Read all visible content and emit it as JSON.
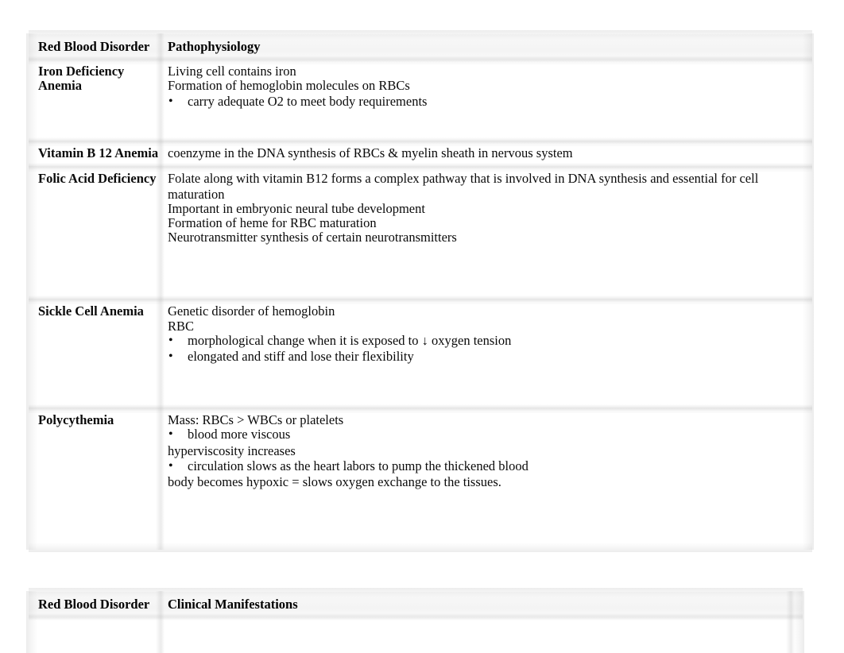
{
  "document": {
    "title": "Red Blood Disorders Study Table",
    "font_color": "#000000",
    "page_background": "#ffffff",
    "header_band_color": "#f4f4f4"
  },
  "table1": {
    "headers": {
      "col1": "Red Blood Disorder",
      "col2": "Pathophysiology"
    },
    "rows": [
      {
        "label": "Iron Deficiency Anemia",
        "label_line1": "Iron Deficiency",
        "label_line2": "Anemia",
        "lines": [
          {
            "type": "plain",
            "text": "Living cell contains iron"
          },
          {
            "type": "plain",
            "text": "Formation of hemoglobin molecules on RBCs"
          },
          {
            "type": "bullet",
            "text": "carry adequate O2 to meet body requirements"
          }
        ]
      },
      {
        "label": "Vitamin B 12 Anemia",
        "lines": [
          {
            "type": "plain",
            "text": "coenzyme in the DNA synthesis of RBCs & myelin sheath in nervous system"
          }
        ]
      },
      {
        "label": "Folic Acid Deficiency",
        "lines": [
          {
            "type": "plain",
            "text": "Folate along with vitamin B12 forms a complex pathway that is involved in DNA synthesis and essential for cell"
          },
          {
            "type": "plain",
            "text": "maturation"
          },
          {
            "type": "plain",
            "text": "Important in embryonic neural tube development"
          },
          {
            "type": "plain",
            "text": "Formation of heme for RBC maturation"
          },
          {
            "type": "plain",
            "text": "Neurotransmitter synthesis of certain neurotransmitters"
          }
        ]
      },
      {
        "label": "Sickle Cell Anemia",
        "lines": [
          {
            "type": "plain",
            "text": "Genetic disorder of hemoglobin"
          },
          {
            "type": "plain",
            "text": "RBC"
          },
          {
            "type": "bullet",
            "text": "morphological change when it is exposed to ↓ oxygen tension"
          },
          {
            "type": "bullet",
            "text": "elongated and stiff and lose their flexibility"
          }
        ]
      },
      {
        "label": "Polycythemia",
        "lines": [
          {
            "type": "plain",
            "text": "Mass: RBCs > WBCs or platelets"
          },
          {
            "type": "bullet",
            "text": "blood more viscous"
          },
          {
            "type": "plain",
            "text": "hyperviscosity increases"
          },
          {
            "type": "bullet",
            "text": "circulation slows as the heart labors to pump the thickened blood"
          },
          {
            "type": "plain",
            "text": "body becomes hypoxic = slows oxygen exchange to the tissues."
          }
        ]
      }
    ]
  },
  "table2": {
    "headers": {
      "col1": "Red Blood Disorder",
      "col2": "Clinical Manifestations"
    },
    "rows": []
  },
  "bullet_glyph": "•"
}
